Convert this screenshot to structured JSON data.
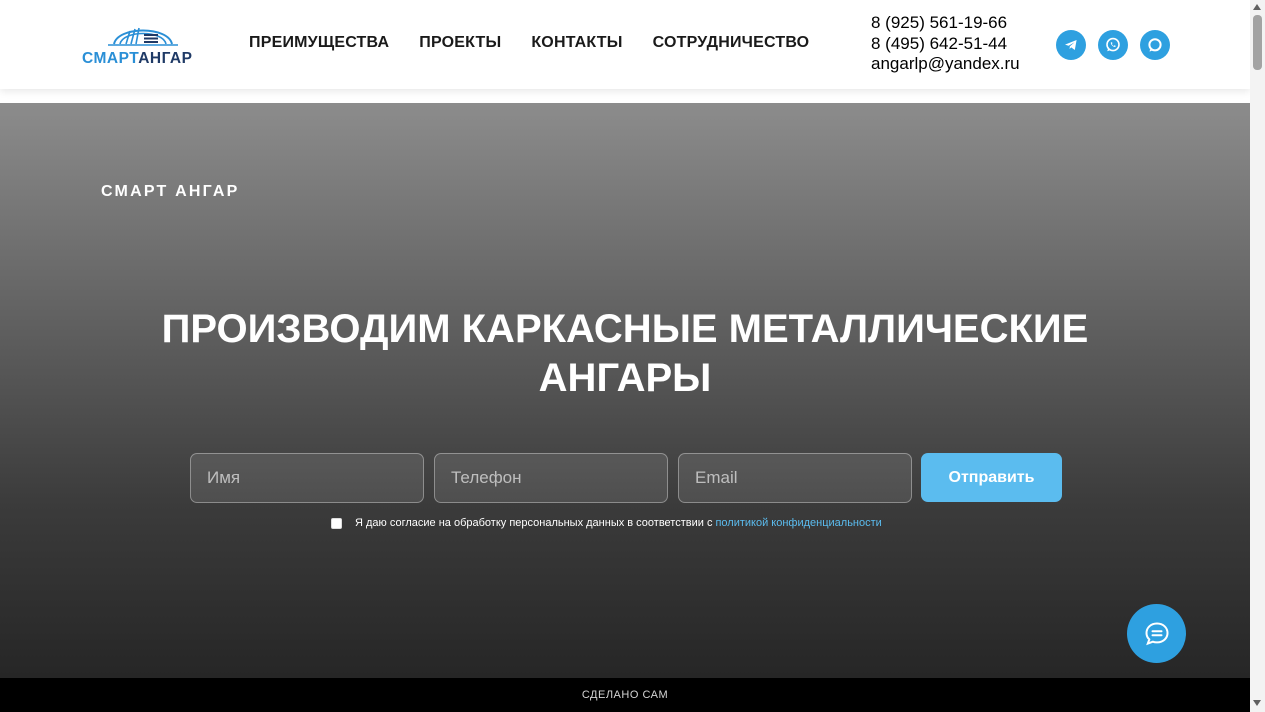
{
  "header": {
    "logo": {
      "text_part1": "СМАРТ",
      "text_part2": "АНГАР",
      "icon": "hangar-logo-icon"
    },
    "nav": [
      {
        "label": "ПРЕИМУЩЕСТВА"
      },
      {
        "label": "ПРОЕКТЫ"
      },
      {
        "label": "КОНТАКТЫ"
      },
      {
        "label": "СОТРУДНИЧЕСТВО"
      }
    ],
    "contacts": {
      "phone1": "8 (925) 561-19-66",
      "phone2": "8 (495) 642-51-44",
      "email": "angarlp@yandex.ru"
    },
    "socials": [
      {
        "icon": "telegram-icon"
      },
      {
        "icon": "whatsapp-icon"
      },
      {
        "icon": "max-messenger-icon"
      }
    ]
  },
  "hero": {
    "brand_label": "СМАРТ АНГАР",
    "title": "ПРОИЗВОДИМ КАРКАСНЫЕ МЕТАЛЛИЧЕСКИЕ АНГАРЫ",
    "form": {
      "name_placeholder": "Имя",
      "phone_placeholder": "Телефон",
      "email_placeholder": "Email",
      "submit_label": "Отправить"
    },
    "consent": {
      "text": "Я даю согласие на обработку персональных данных в соответствии с",
      "link_text": "политикой конфиденциальности"
    }
  },
  "chat_widget": {
    "icon": "chat-icon"
  },
  "footer": {
    "text": "СДЕЛАНО САМ"
  },
  "colors": {
    "accent": "#2ea0e0",
    "button": "#5bbcef",
    "logo_blue": "#2a8fd6",
    "logo_navy": "#1f3a66",
    "footer_bg": "#000000"
  }
}
